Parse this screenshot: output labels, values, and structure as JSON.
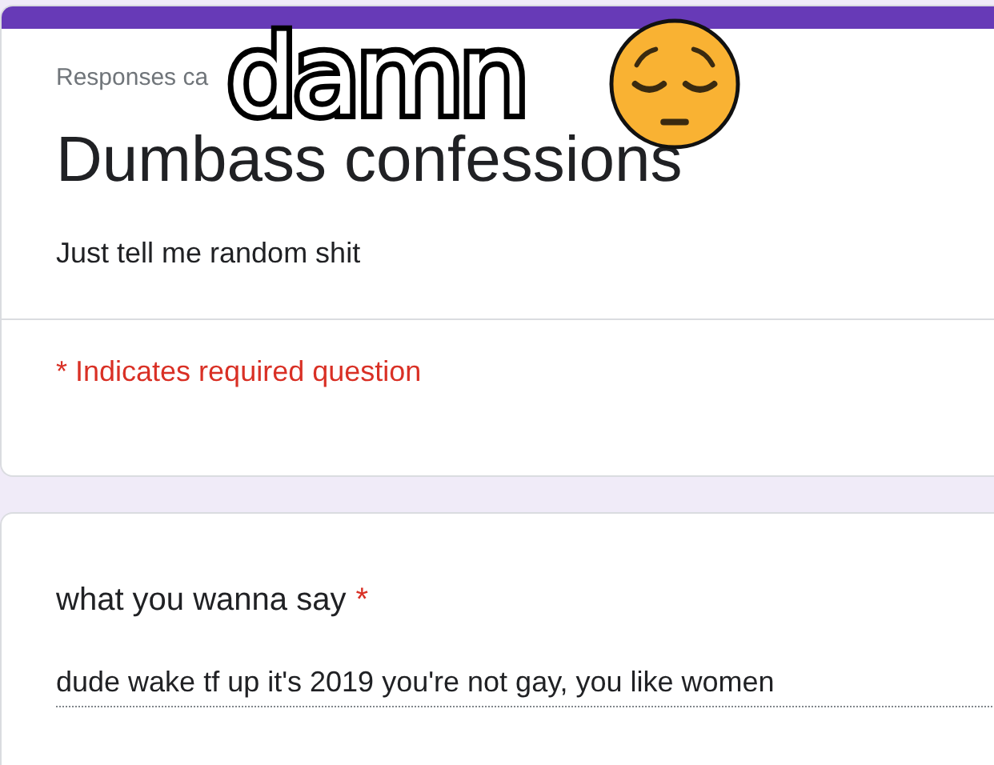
{
  "caption": {
    "text": "damn"
  },
  "form": {
    "notice": "Responses ca",
    "title": "Dumbass confessions",
    "description": "Just tell me random shit",
    "required_note": {
      "marker": "*",
      "text": "Indicates required question"
    }
  },
  "questions": [
    {
      "label": "what you wanna say",
      "required": true,
      "marker": "*",
      "value": "dude wake tf up it's 2019 you're not gay, you like women"
    }
  ]
}
